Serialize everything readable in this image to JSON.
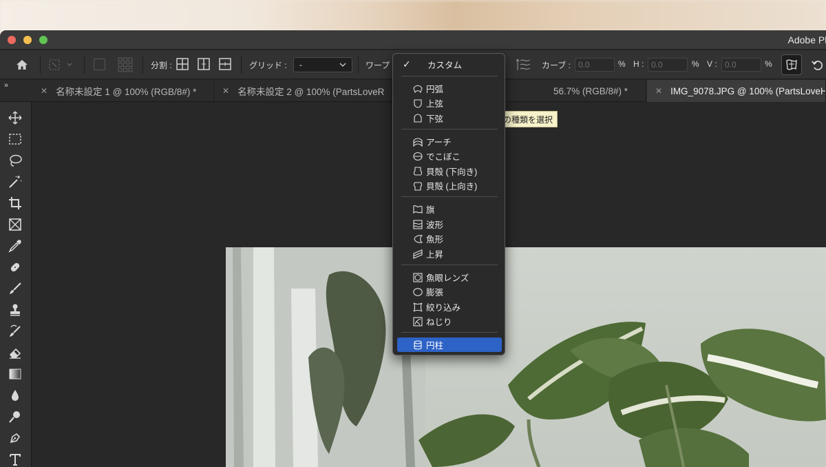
{
  "window": {
    "title": "Adobe Ph"
  },
  "options_bar": {
    "split_label": "分割 :",
    "grid_label": "グリッド :",
    "grid_value": "-",
    "warp_label": "ワープ",
    "curve_label": "カーブ :",
    "curve_value": "0.0",
    "h_label": "H :",
    "h_value": "0.0",
    "v_label": "V :",
    "v_value": "0.0",
    "percent": "%"
  },
  "tabs": [
    {
      "label": "名称未設定 1 @ 100% (RGB/8#) *",
      "active": false
    },
    {
      "label": "名称未設定 2 @ 100% (PartsLoveR",
      "active": false
    },
    {
      "label": "56.7% (RGB/8#) *",
      "active": false
    },
    {
      "label": "IMG_9078.JPG @ 100% (PartsLoveH",
      "active": true
    }
  ],
  "tooltip": {
    "text": "の種類を選択"
  },
  "warp_menu": {
    "custom": "カスタム",
    "items": [
      {
        "label": "円弧",
        "icon": "arc-icon"
      },
      {
        "label": "上弦",
        "icon": "arc-upper-icon"
      },
      {
        "label": "下弦",
        "icon": "arc-lower-icon"
      },
      {
        "label": "アーチ",
        "icon": "arch-icon"
      },
      {
        "label": "でこぼこ",
        "icon": "bulge-icon"
      },
      {
        "label": "貝殻 (下向き)",
        "icon": "shell-lower-icon"
      },
      {
        "label": "貝殻 (上向き)",
        "icon": "shell-upper-icon"
      },
      {
        "label": "旗",
        "icon": "flag-icon"
      },
      {
        "label": "波形",
        "icon": "wave-icon"
      },
      {
        "label": "魚形",
        "icon": "fish-icon"
      },
      {
        "label": "上昇",
        "icon": "rise-icon"
      },
      {
        "label": "魚眼レンズ",
        "icon": "fisheye-icon"
      },
      {
        "label": "膨張",
        "icon": "inflate-icon"
      },
      {
        "label": "絞り込み",
        "icon": "squeeze-icon"
      },
      {
        "label": "ねじり",
        "icon": "twist-icon"
      },
      {
        "label": "円柱",
        "icon": "cylinder-icon",
        "selected": true
      }
    ]
  },
  "colors": {
    "accent": "#2d62c6",
    "panel": "#323232",
    "canvas": "#282828"
  }
}
